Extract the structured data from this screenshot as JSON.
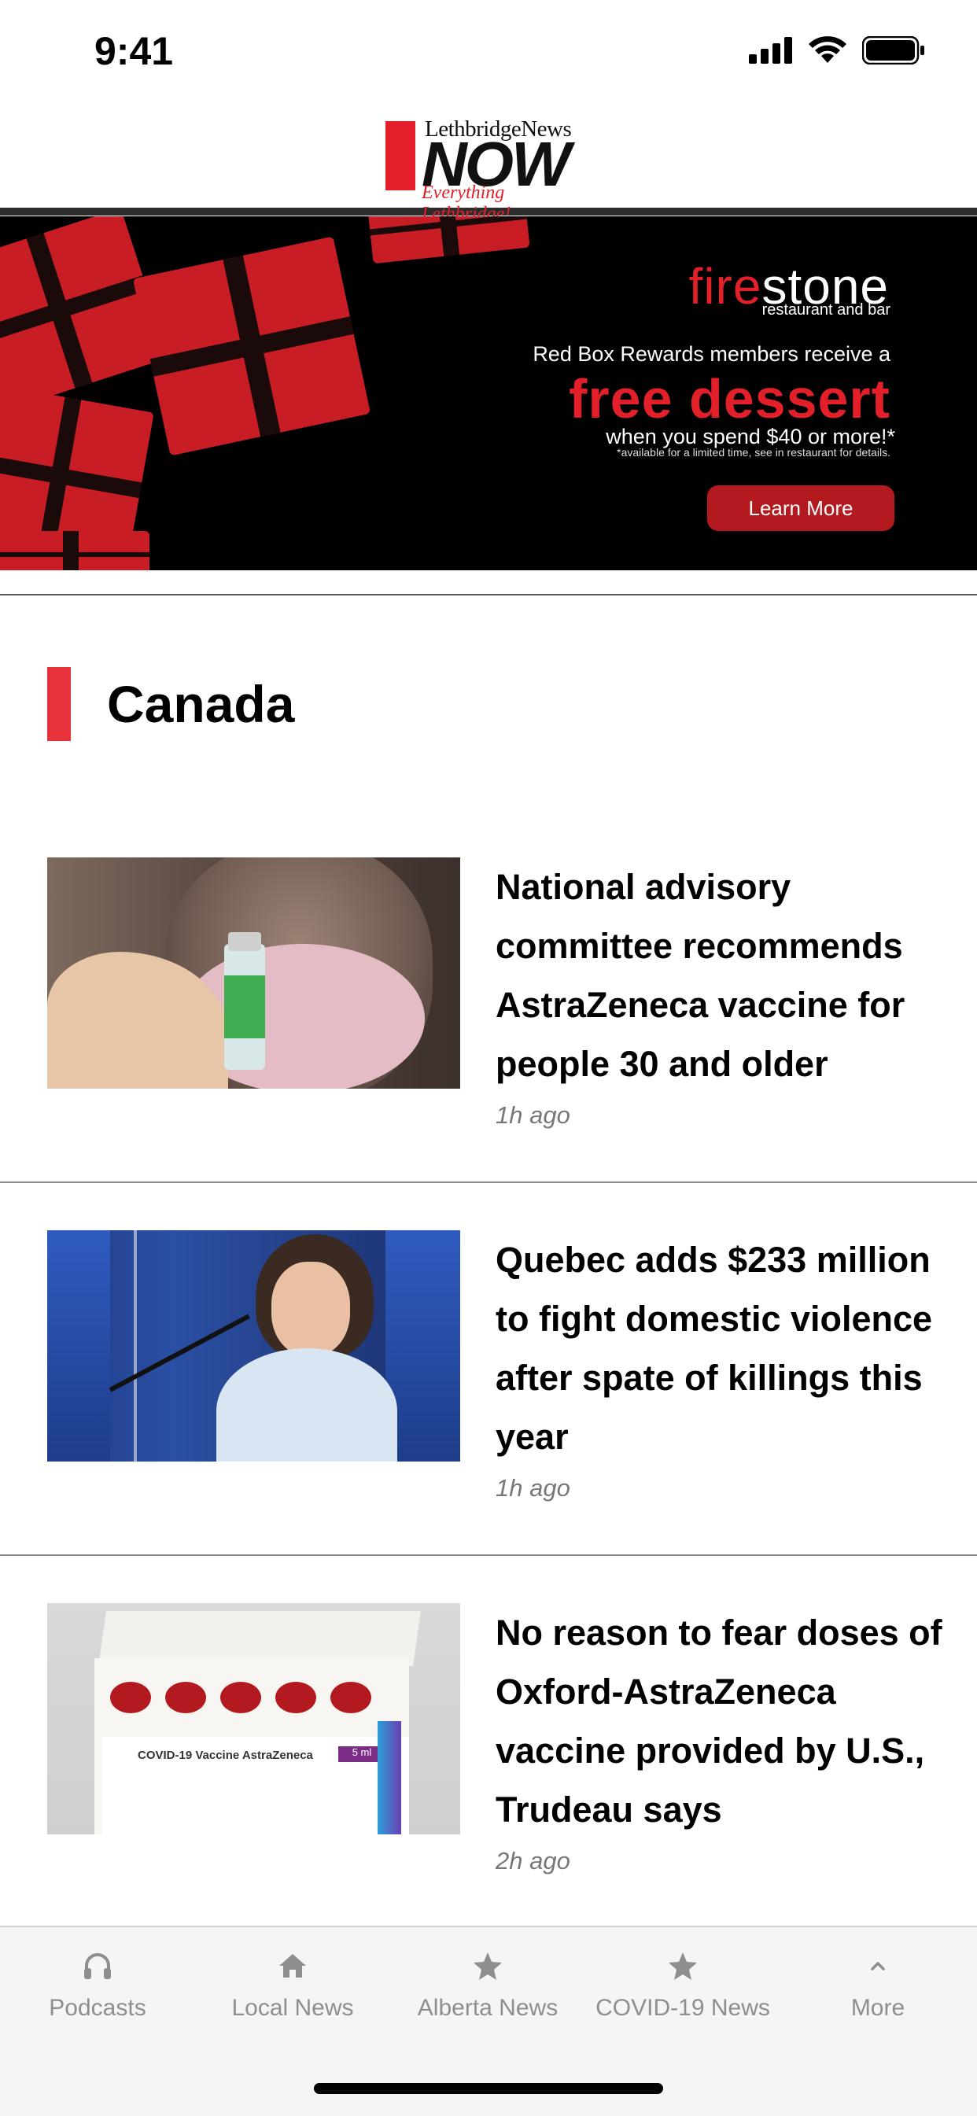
{
  "status_bar": {
    "time": "9:41"
  },
  "header": {
    "logo_top": "LethbridgeNews",
    "logo_main": "NOW",
    "logo_tagline": "Everything Lethbridge!"
  },
  "ad": {
    "brand_part1": "fire",
    "brand_part2": "stone",
    "brand_sub": "restaurant and bar",
    "line1": "Red Box Rewards members receive a",
    "headline": "free dessert",
    "line2": "when you spend $40 or more!*",
    "fine_print": "*available for a limited time, see in restaurant for details.",
    "cta": "Learn More"
  },
  "section": {
    "title": "Canada"
  },
  "articles": [
    {
      "headline": "National advisory committee recommends AstraZeneca vaccine for people 30 and older",
      "time": "1h ago"
    },
    {
      "headline": "Quebec adds $233 million to fight domestic violence after spate of killings this year",
      "time": "1h ago"
    },
    {
      "headline": "No reason to fear doses of Oxford-AstraZeneca vaccine provided by U.S., Trudeau says",
      "time": "2h ago"
    }
  ],
  "thumb3": {
    "box_title": "COVID-19 Vaccine AstraZeneca",
    "box_ml": "5 ml"
  },
  "tabs": [
    {
      "label": "Podcasts",
      "icon": "headphones-icon"
    },
    {
      "label": "Local News",
      "icon": "home-icon"
    },
    {
      "label": "Alberta News",
      "icon": "star-icon"
    },
    {
      "label": "COVID-19 News",
      "icon": "star-icon"
    },
    {
      "label": "More",
      "icon": "chevron-up-icon"
    }
  ],
  "colors": {
    "accent": "#e8323b",
    "tab_inactive": "#8e8e8e",
    "ad_button": "#b21a1f"
  }
}
